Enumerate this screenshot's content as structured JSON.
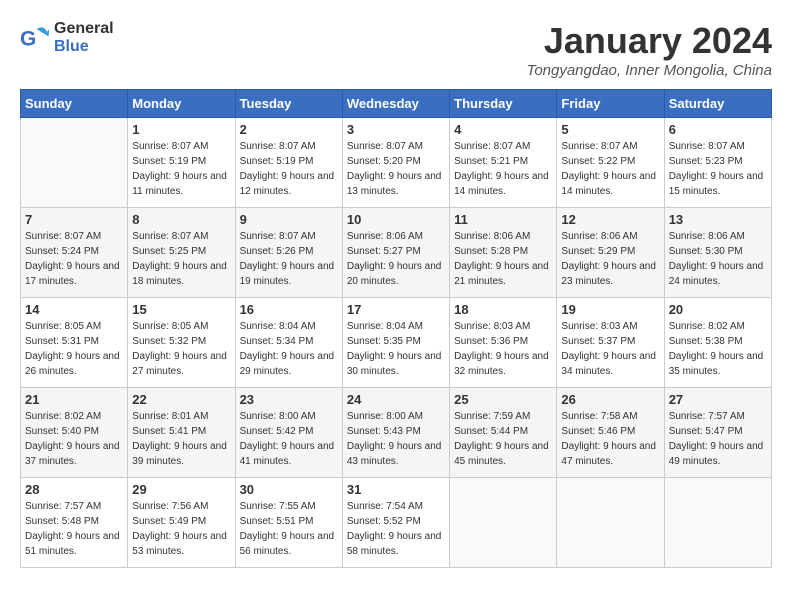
{
  "header": {
    "logo_general": "General",
    "logo_blue": "Blue",
    "month": "January 2024",
    "location": "Tongyangdao, Inner Mongolia, China"
  },
  "days_of_week": [
    "Sunday",
    "Monday",
    "Tuesday",
    "Wednesday",
    "Thursday",
    "Friday",
    "Saturday"
  ],
  "weeks": [
    [
      {
        "num": "",
        "sunrise": "",
        "sunset": "",
        "daylight": ""
      },
      {
        "num": "1",
        "sunrise": "Sunrise: 8:07 AM",
        "sunset": "Sunset: 5:19 PM",
        "daylight": "Daylight: 9 hours and 11 minutes."
      },
      {
        "num": "2",
        "sunrise": "Sunrise: 8:07 AM",
        "sunset": "Sunset: 5:19 PM",
        "daylight": "Daylight: 9 hours and 12 minutes."
      },
      {
        "num": "3",
        "sunrise": "Sunrise: 8:07 AM",
        "sunset": "Sunset: 5:20 PM",
        "daylight": "Daylight: 9 hours and 13 minutes."
      },
      {
        "num": "4",
        "sunrise": "Sunrise: 8:07 AM",
        "sunset": "Sunset: 5:21 PM",
        "daylight": "Daylight: 9 hours and 14 minutes."
      },
      {
        "num": "5",
        "sunrise": "Sunrise: 8:07 AM",
        "sunset": "Sunset: 5:22 PM",
        "daylight": "Daylight: 9 hours and 14 minutes."
      },
      {
        "num": "6",
        "sunrise": "Sunrise: 8:07 AM",
        "sunset": "Sunset: 5:23 PM",
        "daylight": "Daylight: 9 hours and 15 minutes."
      }
    ],
    [
      {
        "num": "7",
        "sunrise": "Sunrise: 8:07 AM",
        "sunset": "Sunset: 5:24 PM",
        "daylight": "Daylight: 9 hours and 17 minutes."
      },
      {
        "num": "8",
        "sunrise": "Sunrise: 8:07 AM",
        "sunset": "Sunset: 5:25 PM",
        "daylight": "Daylight: 9 hours and 18 minutes."
      },
      {
        "num": "9",
        "sunrise": "Sunrise: 8:07 AM",
        "sunset": "Sunset: 5:26 PM",
        "daylight": "Daylight: 9 hours and 19 minutes."
      },
      {
        "num": "10",
        "sunrise": "Sunrise: 8:06 AM",
        "sunset": "Sunset: 5:27 PM",
        "daylight": "Daylight: 9 hours and 20 minutes."
      },
      {
        "num": "11",
        "sunrise": "Sunrise: 8:06 AM",
        "sunset": "Sunset: 5:28 PM",
        "daylight": "Daylight: 9 hours and 21 minutes."
      },
      {
        "num": "12",
        "sunrise": "Sunrise: 8:06 AM",
        "sunset": "Sunset: 5:29 PM",
        "daylight": "Daylight: 9 hours and 23 minutes."
      },
      {
        "num": "13",
        "sunrise": "Sunrise: 8:06 AM",
        "sunset": "Sunset: 5:30 PM",
        "daylight": "Daylight: 9 hours and 24 minutes."
      }
    ],
    [
      {
        "num": "14",
        "sunrise": "Sunrise: 8:05 AM",
        "sunset": "Sunset: 5:31 PM",
        "daylight": "Daylight: 9 hours and 26 minutes."
      },
      {
        "num": "15",
        "sunrise": "Sunrise: 8:05 AM",
        "sunset": "Sunset: 5:32 PM",
        "daylight": "Daylight: 9 hours and 27 minutes."
      },
      {
        "num": "16",
        "sunrise": "Sunrise: 8:04 AM",
        "sunset": "Sunset: 5:34 PM",
        "daylight": "Daylight: 9 hours and 29 minutes."
      },
      {
        "num": "17",
        "sunrise": "Sunrise: 8:04 AM",
        "sunset": "Sunset: 5:35 PM",
        "daylight": "Daylight: 9 hours and 30 minutes."
      },
      {
        "num": "18",
        "sunrise": "Sunrise: 8:03 AM",
        "sunset": "Sunset: 5:36 PM",
        "daylight": "Daylight: 9 hours and 32 minutes."
      },
      {
        "num": "19",
        "sunrise": "Sunrise: 8:03 AM",
        "sunset": "Sunset: 5:37 PM",
        "daylight": "Daylight: 9 hours and 34 minutes."
      },
      {
        "num": "20",
        "sunrise": "Sunrise: 8:02 AM",
        "sunset": "Sunset: 5:38 PM",
        "daylight": "Daylight: 9 hours and 35 minutes."
      }
    ],
    [
      {
        "num": "21",
        "sunrise": "Sunrise: 8:02 AM",
        "sunset": "Sunset: 5:40 PM",
        "daylight": "Daylight: 9 hours and 37 minutes."
      },
      {
        "num": "22",
        "sunrise": "Sunrise: 8:01 AM",
        "sunset": "Sunset: 5:41 PM",
        "daylight": "Daylight: 9 hours and 39 minutes."
      },
      {
        "num": "23",
        "sunrise": "Sunrise: 8:00 AM",
        "sunset": "Sunset: 5:42 PM",
        "daylight": "Daylight: 9 hours and 41 minutes."
      },
      {
        "num": "24",
        "sunrise": "Sunrise: 8:00 AM",
        "sunset": "Sunset: 5:43 PM",
        "daylight": "Daylight: 9 hours and 43 minutes."
      },
      {
        "num": "25",
        "sunrise": "Sunrise: 7:59 AM",
        "sunset": "Sunset: 5:44 PM",
        "daylight": "Daylight: 9 hours and 45 minutes."
      },
      {
        "num": "26",
        "sunrise": "Sunrise: 7:58 AM",
        "sunset": "Sunset: 5:46 PM",
        "daylight": "Daylight: 9 hours and 47 minutes."
      },
      {
        "num": "27",
        "sunrise": "Sunrise: 7:57 AM",
        "sunset": "Sunset: 5:47 PM",
        "daylight": "Daylight: 9 hours and 49 minutes."
      }
    ],
    [
      {
        "num": "28",
        "sunrise": "Sunrise: 7:57 AM",
        "sunset": "Sunset: 5:48 PM",
        "daylight": "Daylight: 9 hours and 51 minutes."
      },
      {
        "num": "29",
        "sunrise": "Sunrise: 7:56 AM",
        "sunset": "Sunset: 5:49 PM",
        "daylight": "Daylight: 9 hours and 53 minutes."
      },
      {
        "num": "30",
        "sunrise": "Sunrise: 7:55 AM",
        "sunset": "Sunset: 5:51 PM",
        "daylight": "Daylight: 9 hours and 56 minutes."
      },
      {
        "num": "31",
        "sunrise": "Sunrise: 7:54 AM",
        "sunset": "Sunset: 5:52 PM",
        "daylight": "Daylight: 9 hours and 58 minutes."
      },
      {
        "num": "",
        "sunrise": "",
        "sunset": "",
        "daylight": ""
      },
      {
        "num": "",
        "sunrise": "",
        "sunset": "",
        "daylight": ""
      },
      {
        "num": "",
        "sunrise": "",
        "sunset": "",
        "daylight": ""
      }
    ]
  ]
}
